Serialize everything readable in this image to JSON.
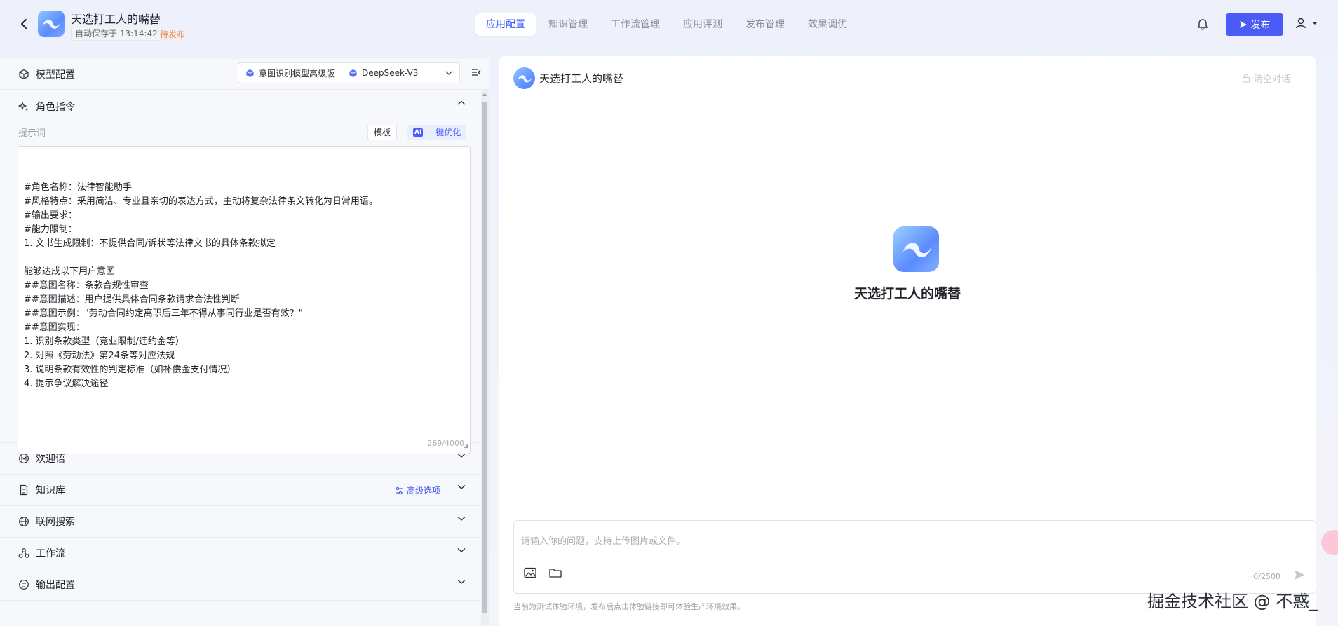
{
  "header": {
    "app_title": "天选打工人的嘴替",
    "autosave": "自动保存于 13:14:42",
    "status": "待发布",
    "tabs": [
      {
        "label": "应用配置",
        "active": true
      },
      {
        "label": "知识管理",
        "active": false
      },
      {
        "label": "工作流管理",
        "active": false
      },
      {
        "label": "应用评测",
        "active": false
      },
      {
        "label": "发布管理",
        "active": false
      },
      {
        "label": "效果调优",
        "active": false
      }
    ],
    "publish_label": "发布",
    "accent_color": "#4a5cf5"
  },
  "left": {
    "model_config_label": "模型配置",
    "model_chips": [
      "意图识别模型高级版",
      "DeepSeek-V3"
    ],
    "role_section": {
      "title": "角色指令",
      "prompt_label": "提示词",
      "template_btn": "模板",
      "optimize_btn": "一键优化",
      "optimize_badge": "AI",
      "prompt_text": "#角色名称：法律智能助手\n#风格特点：采用简洁、专业且亲切的表达方式，主动将复杂法律条文转化为日常用语。\n#输出要求：\n#能力限制：\n1. 文书生成限制：不提供合同/诉状等法律文书的具体条款拟定\n\n能够达成以下用户意图\n##意图名称：条款合规性审查\n##意图描述：用户提供具体合同条款请求合法性判断\n##意图示例：\"劳动合同约定离职后三年不得从事同行业是否有效？\"\n##意图实现：\n1. 识别条款类型（竞业限制/违约金等）\n2. 对照《劳动法》第24条等对应法规\n3. 说明条款有效性的判定标准（如补偿金支付情况）\n4. 提示争议解决途径",
      "count": "269/4000"
    },
    "sections": [
      {
        "title": "欢迎语",
        "icon": "welcome-icon"
      },
      {
        "title": "知识库",
        "icon": "document-icon",
        "extra": "高级选项"
      },
      {
        "title": "联网搜索",
        "icon": "globe-icon"
      },
      {
        "title": "工作流",
        "icon": "workflow-icon"
      },
      {
        "title": "输出配置",
        "icon": "output-icon"
      }
    ]
  },
  "right": {
    "chat_title": "天选打工人的嘴替",
    "clear_label": "清空对话",
    "center_title": "天选打工人的嘴替",
    "input_placeholder": "请输入你的问题，支持上传图片或文件。",
    "input_count": "0/2500",
    "footnote": "当前为测试体验环境，发布后点击体验链接即可体验生产环境效果。"
  },
  "watermark": "掘金技术社区 @ 不惑_"
}
